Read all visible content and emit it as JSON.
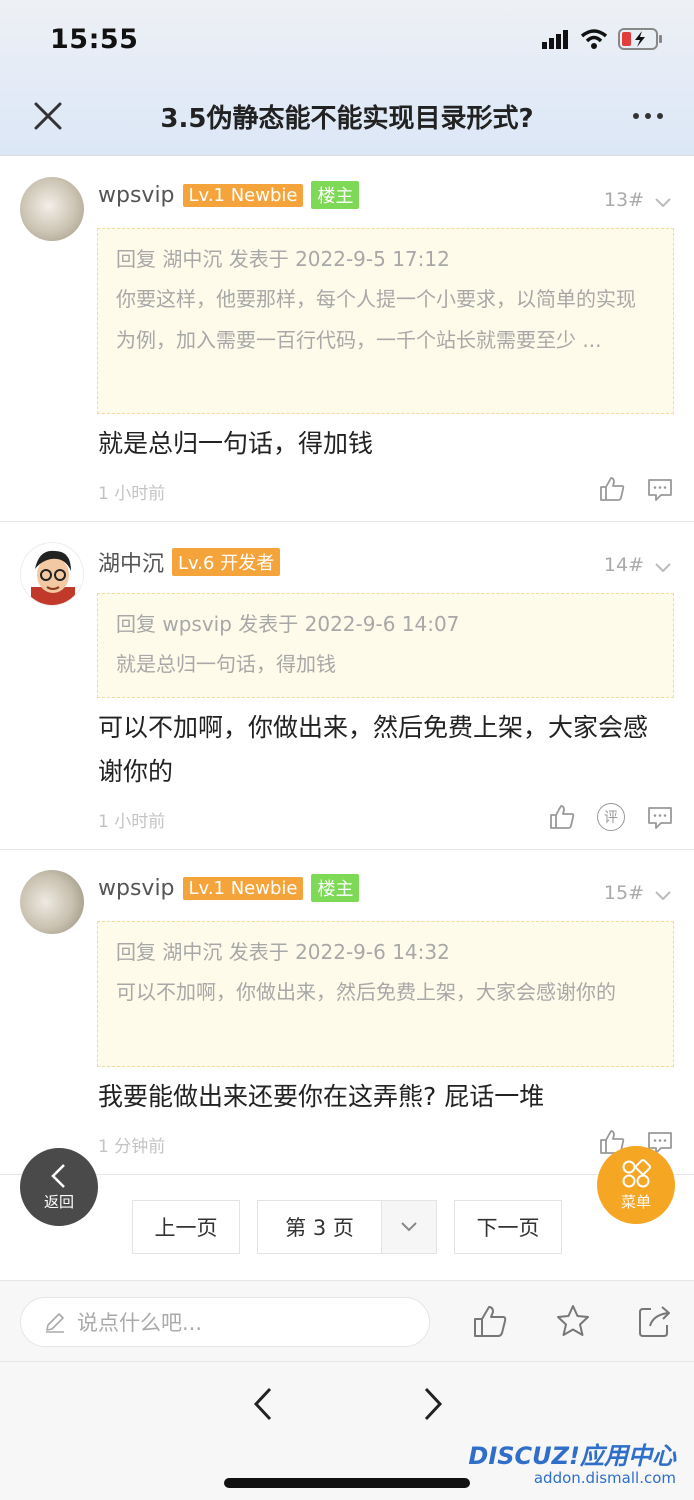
{
  "status_bar": {
    "time": "15:55"
  },
  "nav": {
    "title": "3.5伪静态能不能实现目录形式?"
  },
  "posts": [
    {
      "author": "wpsvip",
      "level": "Lv.1 Newbie",
      "owner_badge": "楼主",
      "floor": "13#",
      "quote_head": "回复 湖中沉 发表于 2022-9-5 17:12",
      "quote_body": "你要这样，他要那样，每个人提一个小要求，以简单的实现为例，加入需要一百行代码，一千个站长就需要至少 ...",
      "content": "就是总归一句话，得加钱",
      "time": "1 小时前"
    },
    {
      "author": "湖中沉",
      "level": "Lv.6 开发者",
      "floor": "14#",
      "quote_head": "回复 wpsvip 发表于 2022-9-6 14:07",
      "quote_body": "就是总归一句话，得加钱",
      "content": "可以不加啊，你做出来，然后免费上架，大家会感谢你的",
      "time": "1 小时前",
      "comment_icon_label": "评"
    },
    {
      "author": "wpsvip",
      "level": "Lv.1 Newbie",
      "owner_badge": "楼主",
      "floor": "15#",
      "quote_head": "回复 湖中沉 发表于 2022-9-6 14:32",
      "quote_body": "可以不加啊，你做出来，然后免费上架，大家会感谢你的",
      "content": "我要能做出来还要你在这弄熊? 屁话一堆",
      "time": "1 分钟前"
    }
  ],
  "fab": {
    "back_label": "返回",
    "menu_label": "菜单"
  },
  "pager": {
    "prev": "上一页",
    "current": "第 3 页",
    "next": "下一页"
  },
  "reply_bar": {
    "placeholder": "说点什么吧..."
  },
  "watermark": {
    "brand": "DISCUZ!应用中心",
    "url": "addon.dismall.com"
  },
  "colors": {
    "level_badge": "#f4a43a",
    "owner_badge": "#7ed957",
    "menu_fab": "#f5a623",
    "quote_bg": "#fffbea"
  }
}
